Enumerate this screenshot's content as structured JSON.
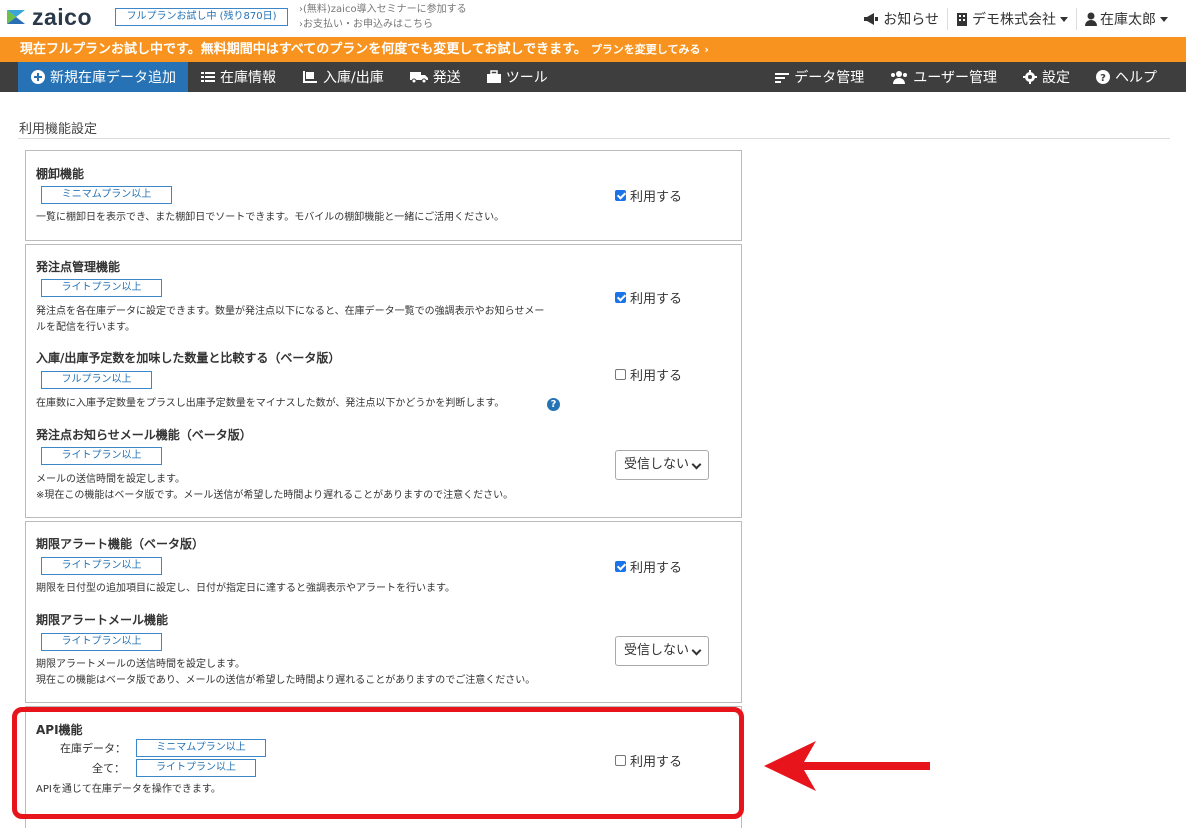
{
  "header": {
    "logo_text": "zaico",
    "trial_badge": "フルプランお試し中 (残り870日)",
    "links": [
      "(無料)zaico導入セミナーに参加する",
      "お支払い・お申込みはこちら"
    ],
    "notices_label": "お知らせ",
    "company_label": "デモ株式会社",
    "user_label": "在庫太郎"
  },
  "banner": {
    "text": "現在フルプランお試し中です。無料期間中はすべてのプランを何度でも変更してお試しできます。",
    "link": "プランを変更してみる"
  },
  "nav": {
    "left": [
      {
        "label": "新規在庫データ追加",
        "icon": "plus-circle-icon"
      },
      {
        "label": "在庫情報",
        "icon": "list-icon"
      },
      {
        "label": "入庫/出庫",
        "icon": "dolly-icon"
      },
      {
        "label": "発送",
        "icon": "truck-icon"
      },
      {
        "label": "ツール",
        "icon": "toolbox-icon"
      }
    ],
    "right": [
      {
        "label": "データ管理",
        "icon": "filter-lines-icon"
      },
      {
        "label": "ユーザー管理",
        "icon": "users-icon"
      },
      {
        "label": "設定",
        "icon": "gear-icon"
      },
      {
        "label": "ヘルプ",
        "icon": "question-circle-icon"
      }
    ]
  },
  "page": {
    "section_title": "利用機能設定"
  },
  "features": {
    "inventory_shelf": {
      "title": "棚卸機能",
      "plan": "ミニマムプラン以上",
      "desc": "一覧に棚卸日を表示でき、また棚卸日でソートできます。モバイルの棚卸機能と一緒にご活用ください。",
      "check_label": "利用する",
      "checked": true
    },
    "reorder_point": {
      "title": "発注点管理機能",
      "plan": "ライトプラン以上",
      "desc1": "発注点を各在庫データに設定できます。数量が発注点以下になると、在庫データ一覧での強調表示やお知らせメー",
      "desc2": "ルを配信を行います。",
      "check_label": "利用する",
      "checked": true
    },
    "scheduled_compare": {
      "title": "入庫/出庫予定数を加味した数量と比較する（ベータ版）",
      "plan": "フルプラン以上",
      "desc": "在庫数に入庫予定数量をプラスし出庫予定数量をマイナスした数が、発注点以下かどうかを判断します。",
      "help": "?",
      "check_label": "利用する",
      "checked": false
    },
    "reorder_mail": {
      "title": "発注点お知らせメール機能（ベータ版）",
      "plan": "ライトプラン以上",
      "desc1": "メールの送信時間を設定します。",
      "desc2": "※現在この機能はベータ版です。メール送信が希望した時間より遅れることがありますので注意ください。",
      "select_value": "受信しない"
    },
    "expiry_alert": {
      "title": "期限アラート機能（ベータ版）",
      "plan": "ライトプラン以上",
      "desc": "期限を日付型の追加項目に設定し、日付が指定日に達すると強調表示やアラートを行います。",
      "check_label": "利用する",
      "checked": true
    },
    "expiry_mail": {
      "title": "期限アラートメール機能",
      "plan": "ライトプラン以上",
      "desc1": "期限アラートメールの送信時間を設定します。",
      "desc2": "現在この機能はベータ版であり、メールの送信が希望した時間より遅れることがありますのでご注意ください。",
      "select_value": "受信しない"
    },
    "api": {
      "title": "API機能",
      "row1_label": "在庫データ：",
      "row1_plan": "ミニマムプラン以上",
      "row2_label": "全て：",
      "row2_plan": "ライトプラン以上",
      "desc": "APIを通じて在庫データを操作できます。",
      "check_label": "利用する",
      "checked": false
    }
  },
  "colors": {
    "banner": "#f7931e",
    "nav": "#3e3e3e",
    "nav_active": "#2672b5",
    "plan_border": "#3b87c8",
    "highlight": "#e8141b"
  }
}
